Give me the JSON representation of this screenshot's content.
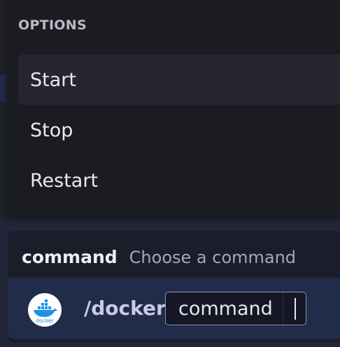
{
  "options_menu": {
    "heading": "OPTIONS",
    "items": [
      {
        "label": "Start",
        "active": true
      },
      {
        "label": "Stop",
        "active": false
      },
      {
        "label": "Restart",
        "active": false
      }
    ]
  },
  "command_bar": {
    "argument_name": "command",
    "argument_description": "Choose a command",
    "bot_icon": "docker-icon",
    "bot_icon_text": "docker",
    "slash_command": "/docker",
    "input_value": "command"
  },
  "colors": {
    "panel": "#1b1c21",
    "active_item": "#25262f",
    "input_row": "#212b4a",
    "docker_blue": "#1d91e6"
  }
}
